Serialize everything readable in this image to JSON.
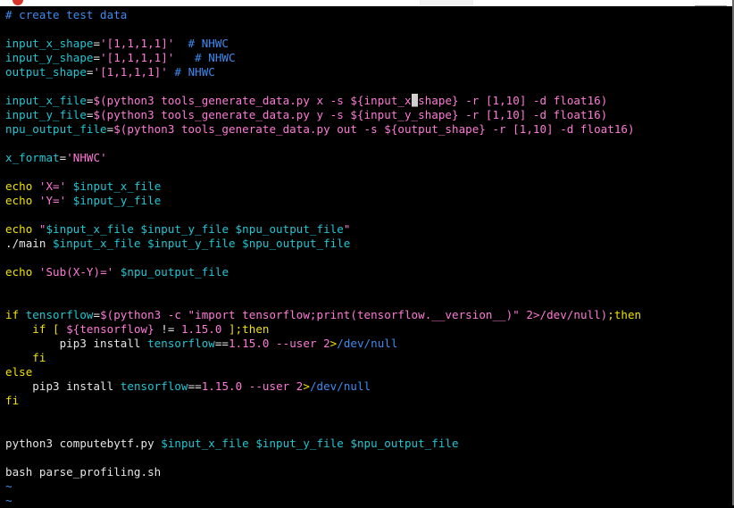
{
  "colors": {
    "background": "#000000",
    "comment": "#3d8bf0",
    "variable": "#20c7d4",
    "string": "#ff7ad8",
    "keyword": "#f0e000",
    "text": "#e6e6e6"
  },
  "icons": [
    "window-close-dot-icon"
  ],
  "lines": [
    {
      "tokens": [
        {
          "t": "# create test data",
          "c": "c-comment"
        }
      ]
    },
    {
      "tokens": []
    },
    {
      "tokens": [
        {
          "t": "input_x_shape",
          "c": "c-var"
        },
        {
          "t": "=",
          "c": "c-text"
        },
        {
          "t": "'[1,1,1,1]'",
          "c": "c-str"
        },
        {
          "t": "  # NHWC",
          "c": "c-comment"
        }
      ]
    },
    {
      "tokens": [
        {
          "t": "input_y_shape",
          "c": "c-var"
        },
        {
          "t": "=",
          "c": "c-text"
        },
        {
          "t": "'[1,1,1,1]'",
          "c": "c-str"
        },
        {
          "t": "   # NHWC",
          "c": "c-comment"
        }
      ]
    },
    {
      "tokens": [
        {
          "t": "output_shape",
          "c": "c-var"
        },
        {
          "t": "=",
          "c": "c-text"
        },
        {
          "t": "'[1,1,1,1]'",
          "c": "c-str"
        },
        {
          "t": " # NHWC",
          "c": "c-comment"
        }
      ]
    },
    {
      "tokens": []
    },
    {
      "tokens": [
        {
          "t": "input_x_file",
          "c": "c-var"
        },
        {
          "t": "=",
          "c": "c-text"
        },
        {
          "t": "$(",
          "c": "c-str"
        },
        {
          "t": "python3 tools_generate_data.py x -s ",
          "c": "c-str"
        },
        {
          "t": "${input_x",
          "c": "c-str"
        },
        {
          "t": "_",
          "c": "cursor"
        },
        {
          "t": "shape}",
          "c": "c-str"
        },
        {
          "t": " -r ",
          "c": "c-str"
        },
        {
          "t": "[1,10]",
          "c": "c-str"
        },
        {
          "t": " -d float16)",
          "c": "c-str"
        }
      ]
    },
    {
      "tokens": [
        {
          "t": "input_y_file",
          "c": "c-var"
        },
        {
          "t": "=",
          "c": "c-text"
        },
        {
          "t": "$(python3 tools_generate_data.py y -s ${input_y_shape} -r [1,10] -d float16)",
          "c": "c-str"
        }
      ]
    },
    {
      "tokens": [
        {
          "t": "npu_output_file",
          "c": "c-var"
        },
        {
          "t": "=",
          "c": "c-text"
        },
        {
          "t": "$(python3 tools_generate_data.py out -s ${output_shape} -r [1,10] -d float16)",
          "c": "c-str"
        }
      ]
    },
    {
      "tokens": []
    },
    {
      "tokens": [
        {
          "t": "x_format",
          "c": "c-var"
        },
        {
          "t": "=",
          "c": "c-text"
        },
        {
          "t": "'NHWC'",
          "c": "c-str"
        }
      ]
    },
    {
      "tokens": []
    },
    {
      "tokens": [
        {
          "t": "echo ",
          "c": "c-kw"
        },
        {
          "t": "'X='",
          "c": "c-str"
        },
        {
          "t": " ",
          "c": "c-text"
        },
        {
          "t": "$input_x_file",
          "c": "c-var"
        }
      ]
    },
    {
      "tokens": [
        {
          "t": "echo ",
          "c": "c-kw"
        },
        {
          "t": "'Y='",
          "c": "c-str"
        },
        {
          "t": " ",
          "c": "c-text"
        },
        {
          "t": "$input_y_file",
          "c": "c-var"
        }
      ]
    },
    {
      "tokens": []
    },
    {
      "tokens": [
        {
          "t": "echo ",
          "c": "c-kw"
        },
        {
          "t": "\"",
          "c": "c-str"
        },
        {
          "t": "$input_x_file",
          "c": "c-var"
        },
        {
          "t": " ",
          "c": "c-str"
        },
        {
          "t": "$input_y_file",
          "c": "c-var"
        },
        {
          "t": " ",
          "c": "c-str"
        },
        {
          "t": "$npu_output_file",
          "c": "c-var"
        },
        {
          "t": "\"",
          "c": "c-str"
        }
      ]
    },
    {
      "tokens": [
        {
          "t": "./main ",
          "c": "c-text"
        },
        {
          "t": "$input_x_file",
          "c": "c-var"
        },
        {
          "t": " ",
          "c": "c-text"
        },
        {
          "t": "$input_y_file",
          "c": "c-var"
        },
        {
          "t": " ",
          "c": "c-text"
        },
        {
          "t": "$npu_output_file",
          "c": "c-var"
        }
      ]
    },
    {
      "tokens": []
    },
    {
      "tokens": [
        {
          "t": "echo ",
          "c": "c-kw"
        },
        {
          "t": "'Sub(X-Y)='",
          "c": "c-str"
        },
        {
          "t": " ",
          "c": "c-text"
        },
        {
          "t": "$npu_output_file",
          "c": "c-var"
        }
      ]
    },
    {
      "tokens": []
    },
    {
      "tokens": []
    },
    {
      "tokens": [
        {
          "t": "if ",
          "c": "c-kw"
        },
        {
          "t": "tensorflow",
          "c": "c-var"
        },
        {
          "t": "=",
          "c": "c-text"
        },
        {
          "t": "$(python3 -c \"import tensorflow;print(tensorflow.__version__)\" 2>/dev/null)",
          "c": "c-str"
        },
        {
          "t": ";then",
          "c": "c-kw"
        }
      ]
    },
    {
      "tokens": [
        {
          "t": "    if ",
          "c": "c-kw"
        },
        {
          "t": "[ ",
          "c": "c-kw"
        },
        {
          "t": "${tensorflow}",
          "c": "c-str"
        },
        {
          "t": " != ",
          "c": "c-text"
        },
        {
          "t": "1.15.0",
          "c": "c-str"
        },
        {
          "t": " ];then",
          "c": "c-kw"
        }
      ]
    },
    {
      "tokens": [
        {
          "t": "        pip3 install ",
          "c": "c-text"
        },
        {
          "t": "tensorflow",
          "c": "c-var"
        },
        {
          "t": "==",
          "c": "c-text"
        },
        {
          "t": "1.15.0",
          "c": "c-str"
        },
        {
          "t": " --user ",
          "c": "c-str"
        },
        {
          "t": "2",
          "c": "c-str"
        },
        {
          "t": ">",
          "c": "c-kw"
        },
        {
          "t": "/dev/null",
          "c": "c-path"
        }
      ]
    },
    {
      "tokens": [
        {
          "t": "    fi",
          "c": "c-kw"
        }
      ]
    },
    {
      "tokens": [
        {
          "t": "else",
          "c": "c-kw"
        }
      ]
    },
    {
      "tokens": [
        {
          "t": "    pip3 install ",
          "c": "c-text"
        },
        {
          "t": "tensorflow",
          "c": "c-var"
        },
        {
          "t": "==",
          "c": "c-text"
        },
        {
          "t": "1.15.0",
          "c": "c-str"
        },
        {
          "t": " --user ",
          "c": "c-str"
        },
        {
          "t": "2",
          "c": "c-str"
        },
        {
          "t": ">",
          "c": "c-kw"
        },
        {
          "t": "/dev/null",
          "c": "c-path"
        }
      ]
    },
    {
      "tokens": [
        {
          "t": "fi",
          "c": "c-kw"
        }
      ]
    },
    {
      "tokens": []
    },
    {
      "tokens": []
    },
    {
      "tokens": [
        {
          "t": "python3 computebytf.py ",
          "c": "c-text"
        },
        {
          "t": "$input_x_file",
          "c": "c-var"
        },
        {
          "t": " ",
          "c": "c-text"
        },
        {
          "t": "$input_y_file",
          "c": "c-var"
        },
        {
          "t": " ",
          "c": "c-text"
        },
        {
          "t": "$npu_output_file",
          "c": "c-var"
        }
      ]
    },
    {
      "tokens": []
    },
    {
      "tokens": [
        {
          "t": "bash parse_profiling.sh",
          "c": "c-text"
        }
      ]
    },
    {
      "tokens": [
        {
          "t": "~",
          "c": "c-tilde"
        }
      ]
    },
    {
      "tokens": [
        {
          "t": "~",
          "c": "c-tilde"
        }
      ]
    }
  ]
}
